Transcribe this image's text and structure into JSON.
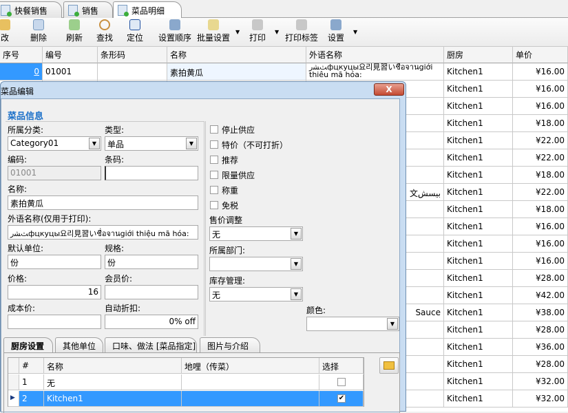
{
  "doc_tabs": [
    {
      "label": "快餐销售"
    },
    {
      "label": "销售"
    },
    {
      "label": "菜品明细",
      "active": true
    }
  ],
  "toolbar": {
    "items": [
      "修改",
      "删除",
      "刷新",
      "查找",
      "定位",
      "设置顺序",
      "批量设置",
      "打印",
      "打印标签",
      "设置"
    ],
    "first_partial": "改"
  },
  "grid": {
    "headers": [
      "序号",
      "编号",
      "条形码",
      "名称",
      "外语名称",
      "厨房",
      "单价"
    ],
    "first_row": {
      "seq": "0",
      "code": "01001",
      "name": "素拍黄瓜",
      "foreign_line1": "ﺚﺸﺭфцкуцы요리見習いชื่อจานgiới",
      "foreign_line2": "thiêu mã hóa:"
    },
    "kitchen": "Kitchen1",
    "prices": [
      "¥16.00",
      "¥16.00",
      "¥16.00",
      "¥18.00",
      "¥22.00",
      "¥22.00",
      "¥18.00",
      "¥22.00",
      "¥18.00",
      "¥16.00",
      "¥16.00",
      "¥16.00",
      "¥28.00",
      "¥42.00",
      "¥38.00",
      "¥28.00",
      "¥36.00",
      "¥28.00",
      "¥32.00",
      "¥32.00"
    ],
    "foreign_partial_row8": "文بيسش",
    "foreign_partial_row15": "Sauce"
  },
  "dialog": {
    "title": "菜品编辑",
    "close": "X",
    "section": "菜品信息",
    "category_label": "所属分类:",
    "category_value": "Category01",
    "type_label": "类型:",
    "type_value": "单品",
    "code_label": "编码:",
    "code_value": "01001",
    "barcode_label": "条码:",
    "barcode_value": "",
    "name_label": "名称:",
    "name_value": "素拍黄瓜",
    "foreign_label": "外语名称(仅用于打印):",
    "foreign_value": "ﺚﺸﺭфцкуцы요리見習いชื่อจานgiới thiệu mã hóa:",
    "unit_label": "默认单位:",
    "unit_value": "份",
    "spec_label": "规格:",
    "spec_value": "份",
    "price_label": "价格:",
    "price_value": "16",
    "member_price_label": "会员价:",
    "member_price_value": "",
    "cost_label": "成本价:",
    "cost_value": "",
    "auto_discount_label": "自动折扣:",
    "auto_discount_value": "0% off",
    "checkboxes": [
      {
        "label": "停止供应",
        "checked": false
      },
      {
        "label": "特价（不可打折）",
        "checked": false
      },
      {
        "label": "推荐",
        "checked": false
      },
      {
        "label": "限量供应",
        "checked": false
      },
      {
        "label": "称重",
        "checked": false
      },
      {
        "label": "免税",
        "checked": false
      }
    ],
    "price_adjust_label": "售价调整",
    "price_adjust_value": "无",
    "department_label": "所属部门:",
    "department_value": "",
    "stock_label": "库存管理:",
    "stock_value": "无",
    "color_label": "颜色:",
    "color_value": "",
    "tabs": [
      "厨房设置",
      "其他单位",
      "口味、做法 [菜品指定]",
      "图片与介绍"
    ],
    "kitchen_grid": {
      "headers": [
        "#",
        "名称",
        "地哩（传菜）",
        "选择"
      ],
      "rows": [
        {
          "num": "1",
          "name": "无",
          "route": "",
          "checked": false
        },
        {
          "num": "2",
          "name": "Kitchen1",
          "route": "",
          "checked": true,
          "selected": true
        }
      ]
    }
  },
  "colors": {
    "selection": "#3399ff",
    "section": "#1a6fc8"
  }
}
